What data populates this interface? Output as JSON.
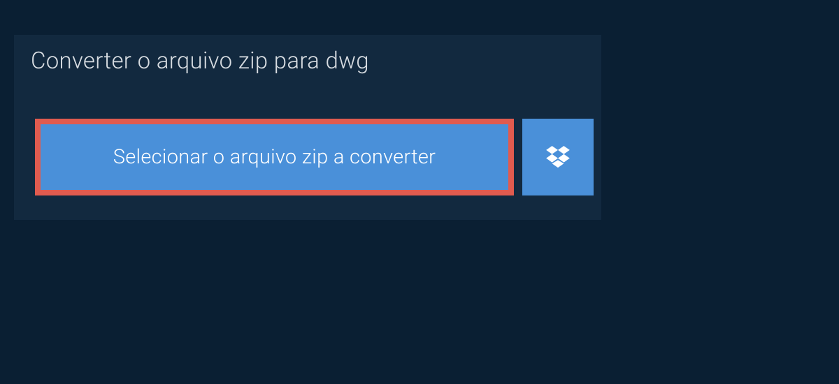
{
  "header": {
    "title": "Converter o arquivo zip para dwg"
  },
  "actions": {
    "select_file_label": "Selecionar o arquivo zip a converter",
    "dropbox_icon": "dropbox"
  },
  "colors": {
    "background": "#0a1f33",
    "panel": "#12293f",
    "button": "#4a90d9",
    "highlight_border": "#e15b4f",
    "text_light": "#d8dde2",
    "text_white": "#ffffff"
  }
}
